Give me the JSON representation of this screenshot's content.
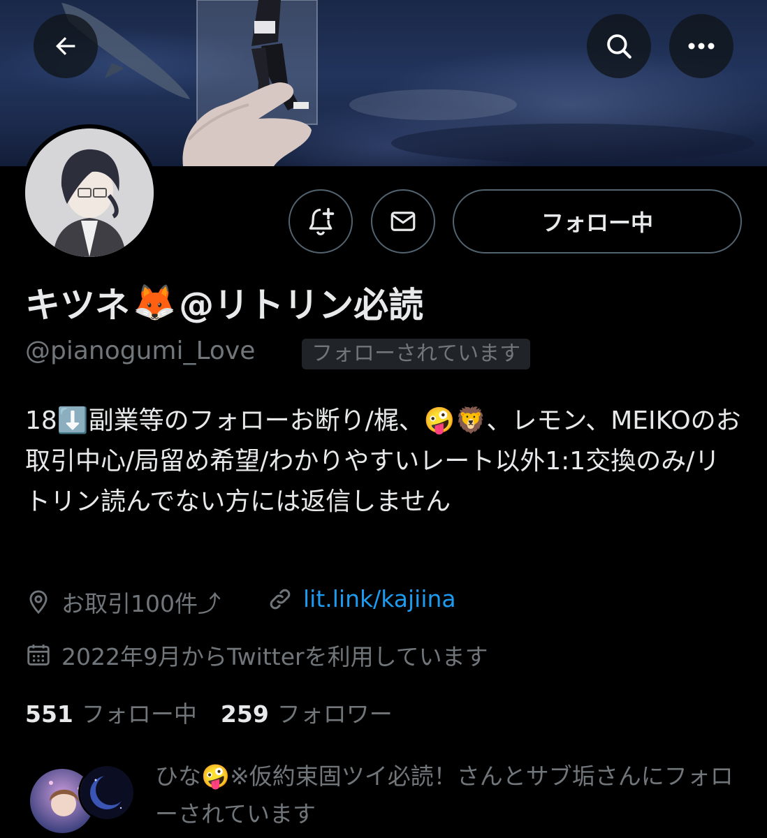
{
  "header": {
    "back_icon": "arrow-left-icon",
    "search_icon": "search-icon",
    "more_icon": "more-horizontal-icon"
  },
  "profile": {
    "display_name_prefix": "キツネ",
    "display_name_emoji": "🦊",
    "display_name_suffix": "@リトリン必読",
    "handle": "@pianogumi_Love",
    "follows_you_badge": "フォローされています",
    "bio": "18⬇️副業等のフォローお断り/梶、🤪🦁、レモン、MEIKOのお取引中心/局留め希望/わかりやすいレート以外1:1交換のみ/リトリン読んでない方には返信しません",
    "location": "お取引100件⤴︎",
    "link": "lit.link/kajiina",
    "joined": "2022年9月からTwitterを利用しています",
    "following_count": "551",
    "following_label": "フォロー中",
    "followers_count": "259",
    "followers_label": "フォロワー",
    "followed_by": "ひな🤪※仮約束固ツイ必読！さんとサブ垢さんにフォローされています"
  },
  "actions": {
    "notify_icon": "bell-plus-icon",
    "message_icon": "envelope-icon",
    "follow_button_label": "フォロー中"
  },
  "colors": {
    "background": "#000000",
    "primary_text": "#e7e9ea",
    "secondary_text": "#71767b",
    "link": "#1d9bf0",
    "border": "#536471"
  }
}
